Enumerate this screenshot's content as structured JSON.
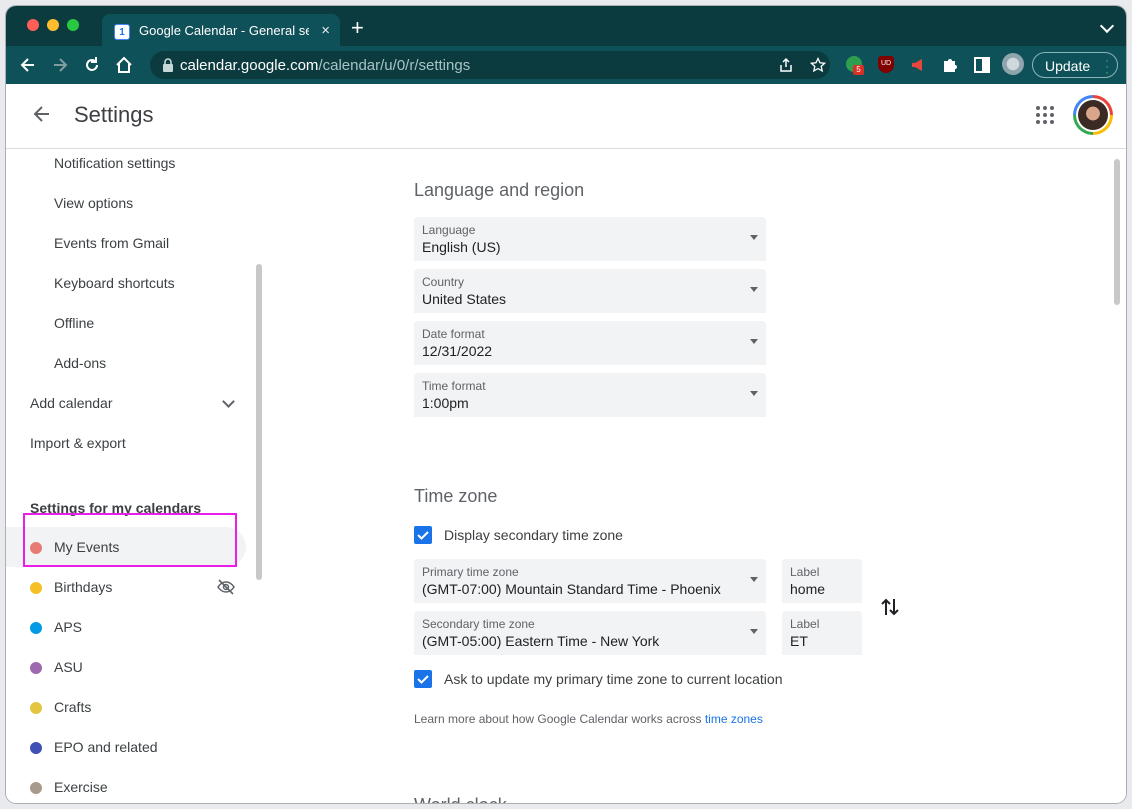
{
  "browser": {
    "tab_title": "Google Calendar - General settings",
    "tab_favicon_text": "1",
    "tab_close": "×",
    "new_tab": "+",
    "url_host": "calendar.google.com",
    "url_path": "/calendar/u/0/r/settings",
    "update_label": "Update",
    "ext_badge": "5",
    "ext_ud": "UD"
  },
  "header": {
    "title": "Settings"
  },
  "sidebar": {
    "sub_items": [
      "Notification settings",
      "View options",
      "Events from Gmail",
      "Keyboard shortcuts",
      "Offline",
      "Add-ons"
    ],
    "add_calendar": "Add calendar",
    "import_export": "Import & export",
    "section_title": "Settings for my calendars",
    "calendars": [
      {
        "name": "My Events",
        "color": "#e67c73"
      },
      {
        "name": "Birthdays",
        "color": "#f6bf26"
      },
      {
        "name": "APS",
        "color": "#039be5"
      },
      {
        "name": "ASU",
        "color": "#9e69af"
      },
      {
        "name": "Crafts",
        "color": "#e4c441"
      },
      {
        "name": "EPO and related",
        "color": "#3f51b5"
      },
      {
        "name": "Exercise",
        "color": "#a79b8e"
      }
    ]
  },
  "language_region": {
    "heading": "Language and region",
    "fields": [
      {
        "label": "Language",
        "value": "English (US)"
      },
      {
        "label": "Country",
        "value": "United States"
      },
      {
        "label": "Date format",
        "value": "12/31/2022"
      },
      {
        "label": "Time format",
        "value": "1:00pm"
      }
    ]
  },
  "time_zone": {
    "heading": "Time zone",
    "display_secondary": "Display secondary time zone",
    "primary_label": "Primary time zone",
    "primary_value": "(GMT-07:00) Mountain Standard Time - Phoenix",
    "primary_tag_label": "Label",
    "primary_tag_value": "home",
    "secondary_label": "Secondary time zone",
    "secondary_value": "(GMT-05:00) Eastern Time - New York",
    "secondary_tag_label": "Label",
    "secondary_tag_value": "ET",
    "ask_update": "Ask to update my primary time zone to current location",
    "learn_more": "Learn more about how Google Calendar works across",
    "learn_link": "time zones"
  },
  "next_heading": "World clock"
}
